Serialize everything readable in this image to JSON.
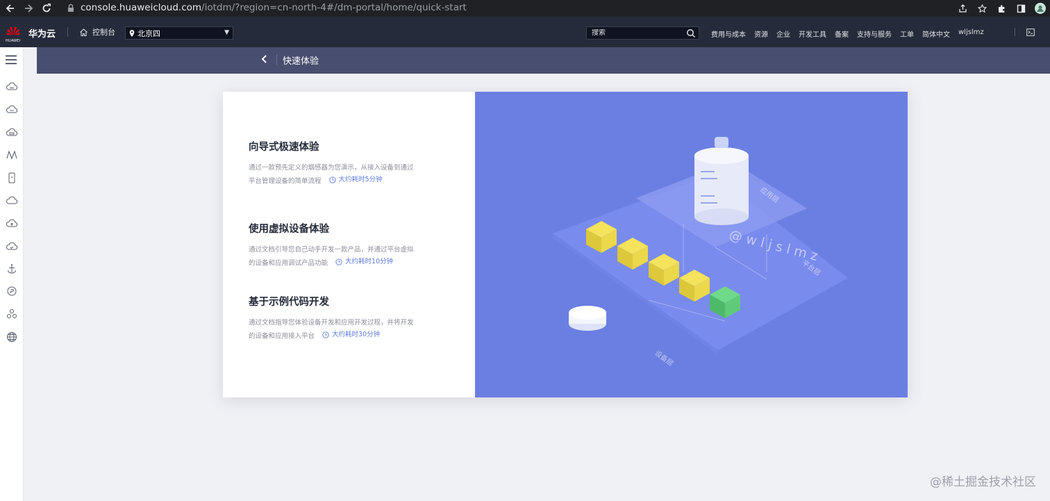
{
  "browser": {
    "url_host": "console.huaweicloud.com",
    "url_path": "/iotdm/?region=cn-north-4#/dm-portal/home/quick-start"
  },
  "topnav": {
    "logo_text": "HUAWEI",
    "brand": "华为云",
    "console": "控制台",
    "region": "北京四",
    "search_placeholder": "搜索",
    "links": [
      "费用与成本",
      "资源",
      "企业",
      "开发工具",
      "备案",
      "支持与服务",
      "工单",
      "简体中文",
      "wljslmz"
    ]
  },
  "subheader": {
    "title": "快速体验"
  },
  "sections": [
    {
      "title": "向导式极速体验",
      "desc_line1": "通过一款预先定义的烟感器为您演示，从接入设备到通过",
      "desc_line2": "平台管理设备的简单流程",
      "time": "大约耗时5分钟"
    },
    {
      "title": "使用虚拟设备体验",
      "desc_line1": "通过文档引导您自己动手开发一款产品，并通过平台虚拟",
      "desc_line2": "的设备和应用调试产品功能",
      "time": "大约耗时10分钟"
    },
    {
      "title": "基于示例代码开发",
      "desc_line1": "通过文档指导您体验设备开发和应用开发过程，并将开发",
      "desc_line2": "的设备和应用接入平台",
      "time": "大约耗时30分钟"
    }
  ],
  "illustration": {
    "watermark": "@wljslmz",
    "layer_app": "应用层",
    "layer_platform": "平台层",
    "layer_device": "设备层"
  },
  "footer_watermark": "@稀土掘金技术社区",
  "colors": {
    "accent": "#5e7ce0",
    "topnav_bg": "#252b3a",
    "subheader_bg": "#484e6f",
    "illustration_bg": "#6b7fe2"
  }
}
